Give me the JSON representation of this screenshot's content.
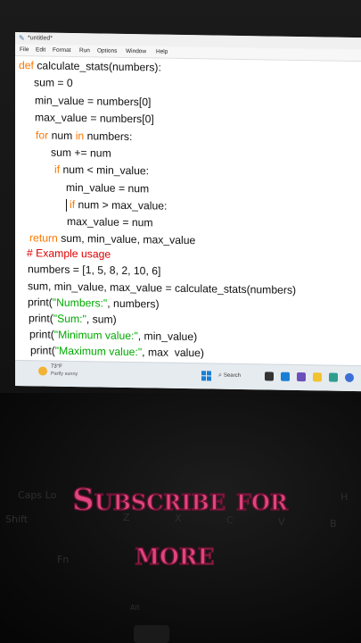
{
  "window": {
    "title": "*untitled*"
  },
  "menu": [
    "File",
    "Edit",
    "Format",
    "Run",
    "Options",
    "Window",
    "Help"
  ],
  "code": {
    "l1_kw": "def",
    "l1_rest": " calculate_stats(numbers):",
    "l2": "sum = 0",
    "l3": "min_value = numbers[0]",
    "l4": "max_value = numbers[0]",
    "l5_kw1": "for",
    "l5_mid": " num ",
    "l5_kw2": "in",
    "l5_rest": " numbers:",
    "l6": "sum += num",
    "l7_kw": "if",
    "l7_rest": " num < min_value:",
    "l8": "min_value = num",
    "l9_kw": "if",
    "l9_rest": " num > max_value:",
    "l10": "max_value = num",
    "l11_kw": "return",
    "l11_rest": " sum, min_value, max_value",
    "l12": "# Example usage",
    "l13": "numbers = [1, 5, 8, 2, 10, 6]",
    "l14": "sum, min_value, max_value = calculate_stats(numbers)",
    "l15_fn": "print(",
    "l15_str": "\"Numbers:\"",
    "l15_rest": ", numbers)",
    "l16_fn": "print(",
    "l16_str": "\"Sum:\"",
    "l16_rest": ", sum)",
    "l17_fn": "print(",
    "l17_str": "\"Minimum value:\"",
    "l17_rest": ", min_value)",
    "l18_fn": "print(",
    "l18_str": "\"Maximum value:\"",
    "l18_rest": ", max  value)"
  },
  "taskbar": {
    "weather_temp": "73°F",
    "weather_desc": "Partly sunny",
    "search_label": "Search",
    "app_colors": [
      "#333333",
      "#1a7fd4",
      "#6b4fbb",
      "#f2c230",
      "#2e9e8f",
      "#3b6fd6"
    ]
  },
  "overlay": {
    "line1": "Subscribe for",
    "line2": "more",
    "color": "#e0457f"
  },
  "keyboard_legends": [
    "Caps Lo",
    "Shift",
    "Fn",
    "Z",
    "X",
    "C",
    "V",
    "B",
    "H",
    "Alt"
  ]
}
